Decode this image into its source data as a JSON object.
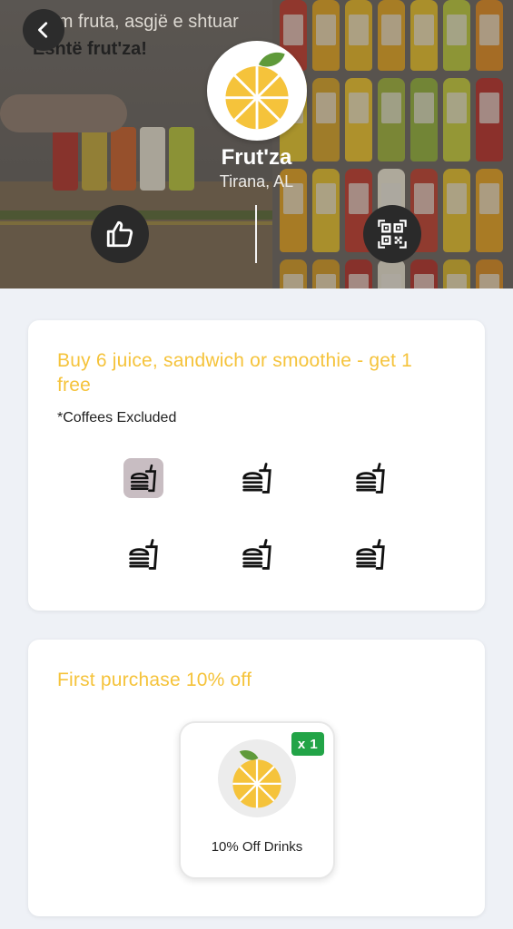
{
  "hero": {
    "slogan_line1": "...em fruta, asgjë e shtuar",
    "slogan_line2": "Është frut'za!",
    "brand_name": "Frut'za",
    "location": "Tirana, AL"
  },
  "actions": {
    "back_icon": "chevron-left-icon",
    "like_icon": "thumbs-up-icon",
    "qr_icon": "qr-code-icon"
  },
  "loyalty": {
    "title": "Buy 6 juice, sandwich or smoothie - get 1 free",
    "note": "*Coffees Excluded",
    "stamps_total": 6,
    "stamps_collected": 1,
    "stamp_icon": "burger-drink-icon"
  },
  "offer": {
    "title": "First purchase 10% off",
    "reward_label": "10% Off Drinks",
    "reward_count": "x 1"
  },
  "colors": {
    "accent_yellow": "#f5c33b",
    "badge_green": "#22a447",
    "stamp_active": "#c8bdc2"
  }
}
